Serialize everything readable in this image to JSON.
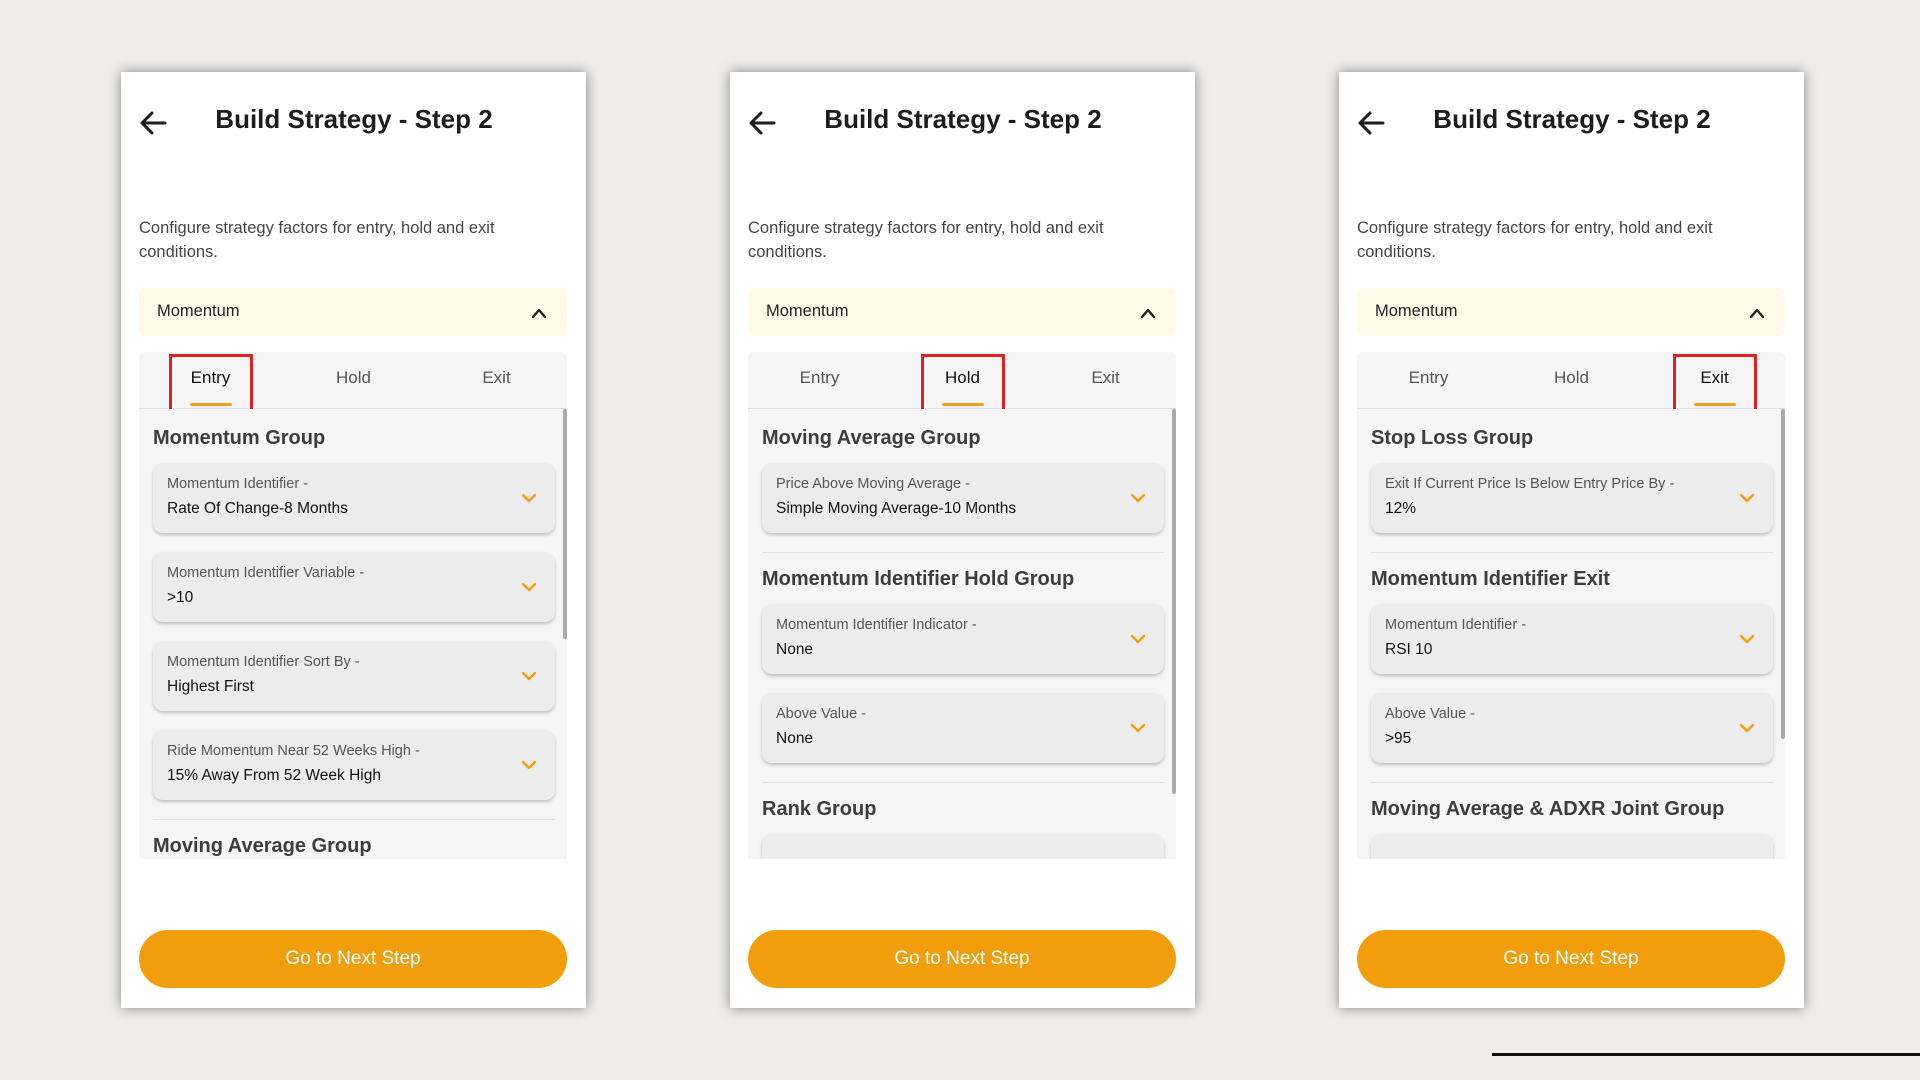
{
  "title": "Build Strategy - Step 2",
  "description": "Configure strategy factors for entry, hold and exit conditions.",
  "section": "Momentum",
  "tabs": [
    "Entry",
    "Hold",
    "Exit"
  ],
  "next_button": "Go to Next Step",
  "colors": {
    "accent": "#f29e0c",
    "highlight_box": "#e02020",
    "section_bg": "#fff9e8"
  },
  "icons": {
    "back": "arrow-left-icon",
    "collapse": "chevron-up-icon",
    "expand": "chevron-down-icon"
  },
  "screens": [
    {
      "active_tab": "Entry",
      "groups": [
        {
          "title": "Momentum Group",
          "fields": [
            {
              "label": "Momentum Identifier -",
              "value": "Rate Of Change-8 Months"
            },
            {
              "label": "Momentum Identifier Variable -",
              "value": ">10"
            },
            {
              "label": "Momentum Identifier Sort By -",
              "value": "Highest First"
            },
            {
              "label": "Ride Momentum Near 52 Weeks High -",
              "value": "15% Away From 52 Week High"
            }
          ]
        },
        {
          "title": "Moving Average Group",
          "fields": []
        }
      ]
    },
    {
      "active_tab": "Hold",
      "groups": [
        {
          "title": "Moving Average Group",
          "fields": [
            {
              "label": "Price Above Moving Average -",
              "value": "Simple Moving Average-10 Months"
            }
          ]
        },
        {
          "title": "Momentum Identifier Hold Group",
          "fields": [
            {
              "label": "Momentum Identifier Indicator -",
              "value": "None"
            },
            {
              "label": "Above Value -",
              "value": "None"
            }
          ]
        },
        {
          "title": "Rank Group",
          "fields": []
        }
      ]
    },
    {
      "active_tab": "Exit",
      "groups": [
        {
          "title": "Stop Loss Group",
          "fields": [
            {
              "label": "Exit If Current Price Is Below Entry Price By -",
              "value": "12%"
            }
          ]
        },
        {
          "title": "Momentum Identifier Exit",
          "fields": [
            {
              "label": "Momentum Identifier -",
              "value": "RSI 10"
            },
            {
              "label": "Above Value -",
              "value": ">95"
            }
          ]
        },
        {
          "title": "Moving Average & ADXR Joint Group",
          "fields": []
        }
      ]
    }
  ]
}
